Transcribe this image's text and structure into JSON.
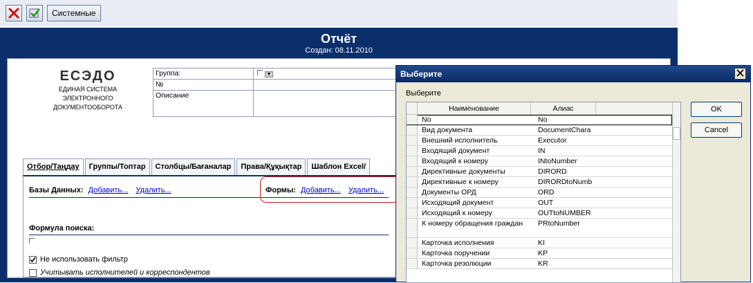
{
  "toolbar": {
    "close_icon": "red-x-icon",
    "confirm_icon": "green-check-icon",
    "system_label": "Системные"
  },
  "report": {
    "title": "Отчёт",
    "created": "Создан: 08.11.2010"
  },
  "logo": {
    "name": "ЕСЭДО",
    "line1": "ЕДИНАЯ СИСТЕМА",
    "line2": "ЭЛЕКТРОННОГО",
    "line3": "ДОКУМЕНТООБОРОТА"
  },
  "form": {
    "group_label": "Группа:",
    "number_label": "№",
    "description_label": "Описание"
  },
  "tabs": [
    "Отбор/Таңдау",
    "Группы/Топтар",
    "Столбцы/Бағаналар",
    "Права/Құқықтар",
    "Шаблон Excel/"
  ],
  "filter": {
    "databases_label": "Базы Данных:",
    "forms_label": "Формы:",
    "add": "Добавить...",
    "remove": "Удалить...",
    "formula_label": "Формула поиска:",
    "no_filter_label": "Не использовать фильтр",
    "no_filter_checked": true,
    "consider_label": "Учитывать исполнителей и корреспондентов",
    "consider_checked": false
  },
  "dialog": {
    "title": "Выберите",
    "label": "Выберите",
    "ok": "OK",
    "cancel": "Cancel",
    "col_name": "Наименование",
    "col_alias": "Алиас",
    "rows": [
      {
        "name": "No",
        "alias": "No"
      },
      {
        "name": "Вид документа",
        "alias": "DocumentChara"
      },
      {
        "name": "Внешний исполнитель",
        "alias": "Executor"
      },
      {
        "name": "Входящий документ",
        "alias": "IN"
      },
      {
        "name": "Входящий к номеру",
        "alias": "INtoNumber"
      },
      {
        "name": "Директивные документы",
        "alias": "DIRORD"
      },
      {
        "name": "Директивные к номеру",
        "alias": "DIRORDtoNumb"
      },
      {
        "name": "Документы ОРД",
        "alias": "ORD"
      },
      {
        "name": "Исходящий документ",
        "alias": "OUT"
      },
      {
        "name": "Исходящий к номеру",
        "alias": "OUTtoNUMBER"
      },
      {
        "name": "К номеру обращения граждан",
        "alias": "PRtoNumber"
      },
      {
        "name": "Карточка исполнения",
        "alias": "KI"
      },
      {
        "name": "Карточка поручении",
        "alias": "KP"
      },
      {
        "name": "Карточка резолюции",
        "alias": "KR"
      }
    ]
  }
}
